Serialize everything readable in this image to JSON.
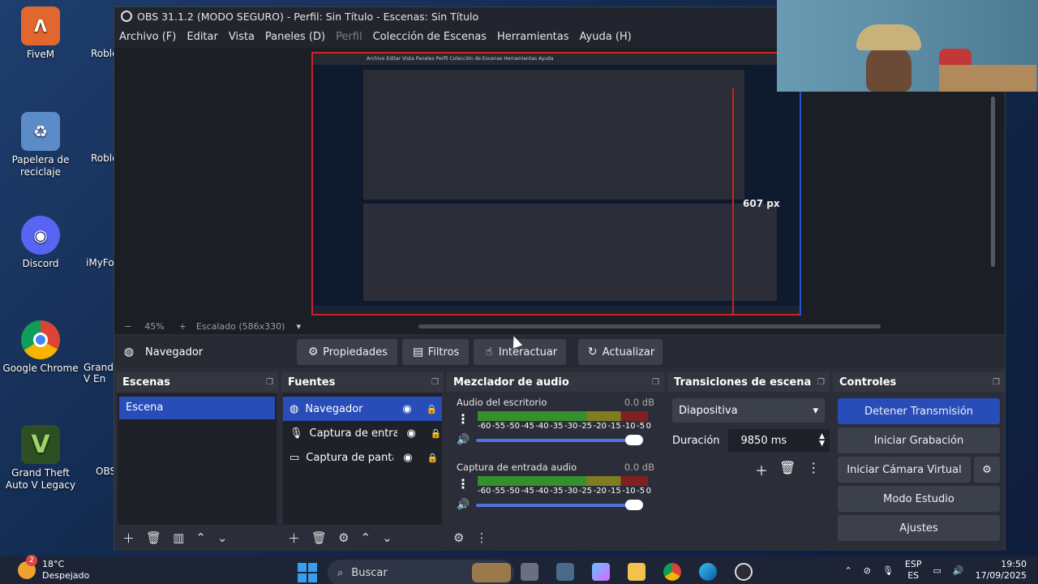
{
  "desktop": {
    "icons": [
      {
        "label": "FiveM",
        "color": "#e2672e",
        "glyph": "Λ"
      },
      {
        "label": "Papelera de reciclaje",
        "color": "#5b8cc8",
        "glyph": "♻"
      },
      {
        "label": "Discord",
        "color": "#5865f2",
        "glyph": "◉"
      },
      {
        "label": "Google Chrome",
        "color": "#2f9e44",
        "glyph": "◎"
      },
      {
        "label": "Grand Theft Auto V Legacy",
        "color": "#3d6b2e",
        "glyph": "V"
      }
    ],
    "partial_labels": [
      "Roblo",
      "Roblo",
      "iMyFo",
      "Grand V En",
      "OBS"
    ]
  },
  "window": {
    "title": "OBS 31.1.2 (MODO SEGURO) - Perfil: Sin Título - Escenas: Sin Título",
    "menu": [
      "Archivo (F)",
      "Editar",
      "Vista",
      "Paneles (D)",
      "Perfil",
      "Colección de Escenas",
      "Herramientas",
      "Ayuda (H)"
    ],
    "disabled_menu": "Perfil"
  },
  "preview": {
    "px_label": "607 px",
    "inner_title": "Archivo Editar Vista Paneles Perfil Colección de Escenas Herramientas Ayuda"
  },
  "zoombar": {
    "minus": "−",
    "zoom": "45%",
    "plus": "+",
    "scale": "Escalado (586x330)"
  },
  "sourcebar": {
    "source_name": "Navegador",
    "buttons": [
      "Propiedades",
      "Filtros",
      "Interactuar",
      "Actualizar"
    ]
  },
  "scenes": {
    "title": "Escenas",
    "items": [
      "Escena"
    ]
  },
  "sources": {
    "title": "Fuentes",
    "items": [
      "Navegador",
      "Captura de entrac",
      "Captura de pantal"
    ]
  },
  "mixer": {
    "title": "Mezclador de audio",
    "channels": [
      {
        "name": "Audio del escritorio",
        "db": "0.0 dB"
      },
      {
        "name": "Captura de entrada audio",
        "db": "0.0 dB"
      }
    ],
    "ticks": [
      "-60",
      "-55",
      "-50",
      "-45",
      "-40",
      "-35",
      "-30",
      "-25",
      "-20",
      "-15",
      "-10",
      "-5",
      "0"
    ]
  },
  "transitions": {
    "title": "Transiciones de escena",
    "selected": "Diapositiva",
    "duration_label": "Duración",
    "duration_value": "9850 ms"
  },
  "controls": {
    "title": "Controles",
    "buttons": [
      "Detener Transmisión",
      "Iniciar Grabación",
      "Iniciar Cámara Virtual",
      "Modo Estudio",
      "Ajustes"
    ]
  },
  "taskbar": {
    "weather_temp": "18°C",
    "weather_desc": "Despejado",
    "weather_badge": "2",
    "search_placeholder": "Buscar",
    "lang_top": "ESP",
    "lang_bottom": "ES",
    "time": "19:50",
    "date": "17/09/2025"
  },
  "colors": {
    "accent": "#284cb8",
    "record_red": "#cc2222",
    "panel_bg": "#2b2e38"
  }
}
